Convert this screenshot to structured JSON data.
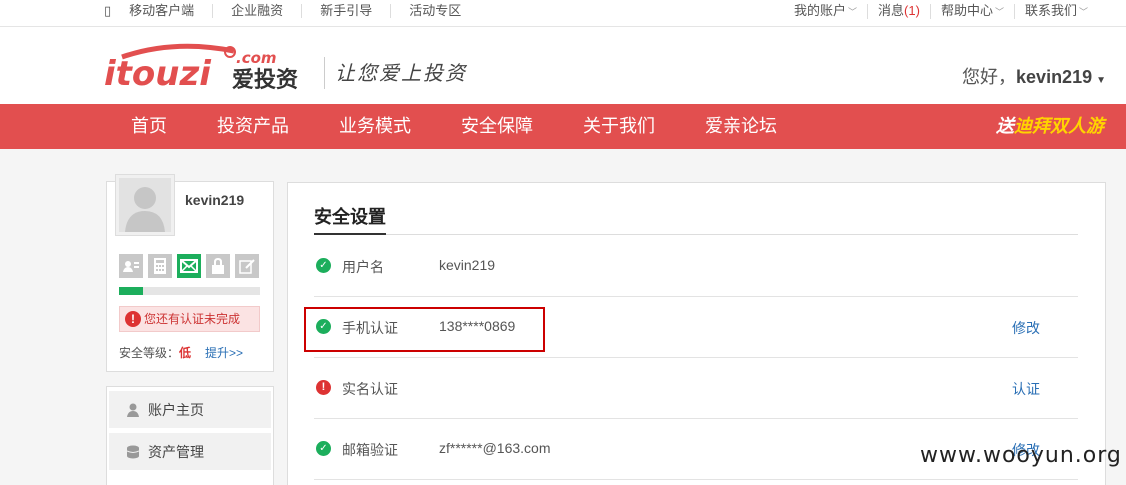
{
  "topbar": {
    "left": [
      "移动客户端",
      "企业融资",
      "新手引导",
      "活动专区"
    ],
    "account": "我的账户",
    "messages": "消息",
    "message_count": "(1)",
    "help": "帮助中心",
    "contact": "联系我们"
  },
  "header": {
    "logo_text": "itouzi",
    "logo_com": ".com",
    "logo_cn": "爱投资",
    "slogan": "让您爱上投资",
    "greeting_prefix": "您好，",
    "greeting_user": "kevin219"
  },
  "nav": {
    "items": [
      "首页",
      "投资产品",
      "业务模式",
      "安全保障",
      "关于我们",
      "爱亲论坛"
    ],
    "promo_prefix": "送",
    "promo_highlight": "迪拜双人游"
  },
  "profile": {
    "username": "kevin219",
    "icons": [
      "id-card-icon",
      "calculator-icon",
      "email-icon",
      "lock-icon",
      "edit-icon"
    ],
    "progress_fraction": 0.17,
    "warning": "您还有认证未完成",
    "level_label": "安全等级：",
    "level_value": "低",
    "upgrade": "提升>>"
  },
  "sidemenu": {
    "items": [
      "账户主页",
      "资产管理"
    ]
  },
  "main": {
    "title": "安全设置",
    "rows": [
      {
        "status": "ok",
        "label": "用户名",
        "value": "kevin219",
        "action": ""
      },
      {
        "status": "ok",
        "label": "手机认证",
        "value": "138****0869",
        "action": "修改"
      },
      {
        "status": "bad",
        "label": "实名认证",
        "value": "",
        "action": "认证"
      },
      {
        "status": "ok",
        "label": "邮箱验证",
        "value": "zf******@163.com",
        "action": "修改"
      }
    ]
  },
  "watermark": "www.wooyun.org",
  "colors": {
    "brand_red": "#e24f4f",
    "success_green": "#1cae5c",
    "link_blue": "#2a6fb5"
  }
}
